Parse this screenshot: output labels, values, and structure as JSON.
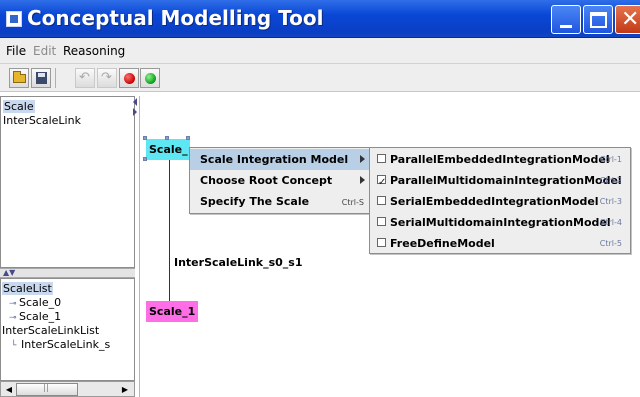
{
  "window": {
    "title": "Conceptual Modelling Tool",
    "minimize_icon": "minimize-icon",
    "maximize_icon": "maximize-icon",
    "close_icon": "close-icon",
    "title_bar_color": "#0a47d6"
  },
  "menubar": {
    "file": "File",
    "edit": "Edit",
    "reasoning": "Reasoning"
  },
  "toolbar": {
    "buttons": [
      {
        "icon": "open-folder-icon"
      },
      {
        "icon": "save-icon"
      },
      {
        "icon": "undo-icon",
        "enabled": false
      },
      {
        "icon": "redo-icon",
        "enabled": false
      },
      {
        "icon": "red-circle-icon",
        "color": "#c80000"
      },
      {
        "icon": "green-circle-icon",
        "color": "#0a9a1a"
      }
    ]
  },
  "top_list": {
    "items": [
      "Scale",
      "InterScaleLink"
    ],
    "selected": "Scale"
  },
  "tree": {
    "root1": "ScaleList",
    "children1": [
      "Scale_0",
      "Scale_1"
    ],
    "root2": "InterScaleLinkList",
    "children2": [
      "InterScaleLink_s"
    ]
  },
  "canvas": {
    "nodes": [
      {
        "label": "Scale_",
        "color": "#5ee6f2"
      },
      {
        "label": "Scale_1",
        "color": "#ff6ee6"
      }
    ],
    "edge_label": "InterScaleLink_s0_s1"
  },
  "context_menu": {
    "items": [
      {
        "label": "Scale Integration Model",
        "submenu": true,
        "highlighted": true
      },
      {
        "label": "Choose Root Concept",
        "submenu": true
      },
      {
        "label": "Specify The Scale",
        "shortcut": "Ctrl-S"
      }
    ]
  },
  "submenu": {
    "items": [
      {
        "label": "ParallelEmbeddedIntegrationModel",
        "shortcut": "Ctrl-1",
        "checked": false
      },
      {
        "label": "ParallelMultidomainIntegrationModel",
        "shortcut": "Ctrl-2",
        "checked": true
      },
      {
        "label": "SerialEmbeddedIntegrationModel",
        "shortcut": "Ctrl-3",
        "checked": false
      },
      {
        "label": "SerialMultidomainIntegrationModel",
        "shortcut": "Ctrl-4",
        "checked": false
      },
      {
        "label": "FreeDefineModel",
        "shortcut": "Ctrl-5",
        "checked": false
      }
    ]
  }
}
